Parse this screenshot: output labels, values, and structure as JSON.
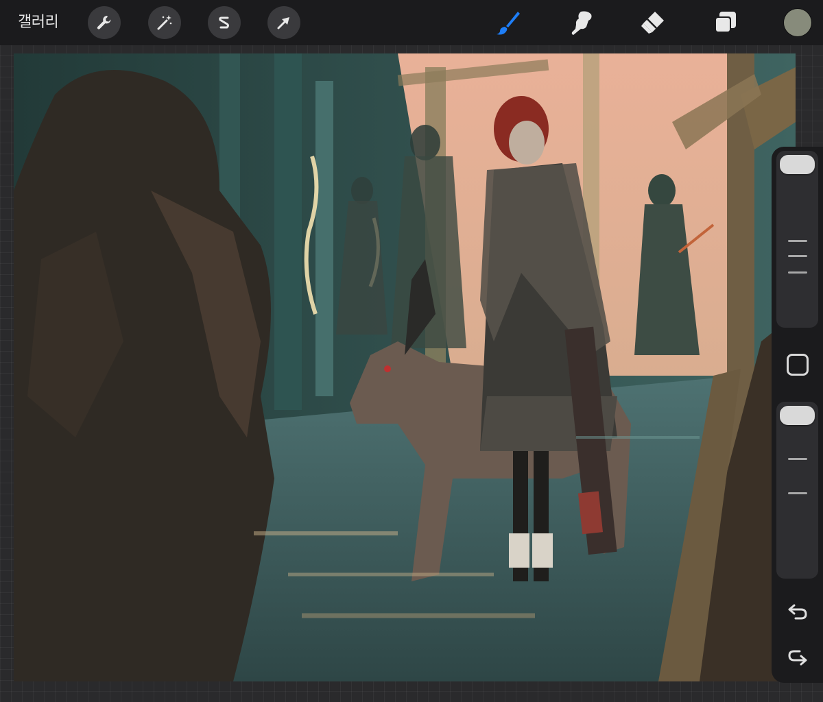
{
  "app": {
    "gallery_label": "갤러리"
  },
  "toolbar": {
    "left_tools": [
      {
        "icon": "wrench-icon",
        "name": "actions"
      },
      {
        "icon": "magic-wand-icon",
        "name": "adjustments"
      },
      {
        "icon": "selection-s-icon",
        "name": "selection"
      },
      {
        "icon": "arrow-cursor-icon",
        "name": "transform"
      }
    ],
    "right_tools": [
      {
        "icon": "brush-icon",
        "name": "paint",
        "active": true
      },
      {
        "icon": "smudge-icon",
        "name": "smudge",
        "active": false
      },
      {
        "icon": "eraser-icon",
        "name": "erase",
        "active": false
      },
      {
        "icon": "layers-icon",
        "name": "layers",
        "active": false
      }
    ],
    "active_color": "#878b7b",
    "accent_color": "#1e7ef7"
  },
  "sidebar": {
    "brush_size_level": 1.0,
    "opacity_level": 1.0,
    "modify_icon": "square-icon",
    "undo_icon": "undo-arrow-icon",
    "redo_icon": "redo-arrow-icon"
  }
}
